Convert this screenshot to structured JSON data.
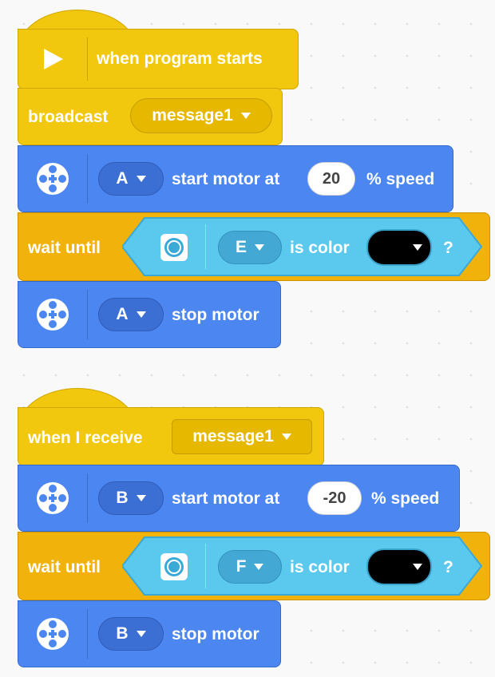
{
  "script1": {
    "hat_label": "when program starts",
    "broadcast_label": "broadcast",
    "broadcast_message": "message1",
    "start_motor": {
      "port": "A",
      "label": "start motor at",
      "speed": "20",
      "unit": "% speed"
    },
    "wait": {
      "label": "wait until",
      "port": "E",
      "is_color": "is color",
      "color": "#000000",
      "question": "?"
    },
    "stop_motor": {
      "port": "A",
      "label": "stop motor"
    }
  },
  "script2": {
    "hat_label": "when I receive",
    "hat_message": "message1",
    "start_motor": {
      "port": "B",
      "label": "start motor at",
      "speed": "-20",
      "unit": "% speed"
    },
    "wait": {
      "label": "wait until",
      "port": "F",
      "is_color": "is color",
      "color": "#000000",
      "question": "?"
    },
    "stop_motor": {
      "port": "B",
      "label": "stop motor"
    }
  },
  "colors": {
    "events_yellow": "#f2c80e",
    "motor_blue": "#4c86f0",
    "control_orange": "#f0b20b",
    "sensor_cyan": "#5bc8ee"
  }
}
